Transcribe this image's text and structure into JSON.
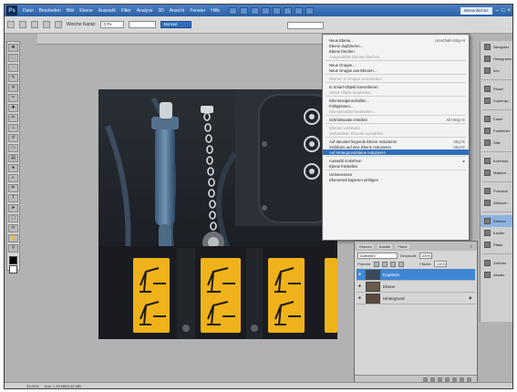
{
  "app": {
    "logo": "Ps",
    "workspace": "Wesentliches",
    "window_controls": [
      "–",
      "□",
      "×"
    ]
  },
  "menu": [
    "Datei",
    "Bearbeiten",
    "Bild",
    "Ebene",
    "Auswahl",
    "Filter",
    "Analyse",
    "3D",
    "Ansicht",
    "Fenster",
    "Hilfe"
  ],
  "options": {
    "feather_label": "Weiche Kante:",
    "feather_value": "0 Px",
    "mode_value": "Normal"
  },
  "context_menu": {
    "items": [
      {
        "label": "Neue Ebene...",
        "shortcut": "Umschalt+Strg+N",
        "state": "normal"
      },
      {
        "label": "Ebene duplizieren...",
        "shortcut": "",
        "state": "normal"
      },
      {
        "label": "Ebene löschen",
        "shortcut": "",
        "state": "normal"
      },
      {
        "label": "Ausgewählte Ebenen löschen",
        "shortcut": "",
        "state": "disabled"
      },
      {
        "label": "Neue Gruppe...",
        "shortcut": "",
        "state": "normal",
        "gap": true
      },
      {
        "label": "Neue Gruppe aus Ebenen...",
        "shortcut": "",
        "state": "normal"
      },
      {
        "label": "Ebenen in Gruppe verschieben",
        "shortcut": "",
        "state": "disabled",
        "gap": true
      },
      {
        "label": "In Smart-Objekt konvertieren",
        "shortcut": "",
        "state": "normal",
        "gap": true
      },
      {
        "label": "Smart-Objekt bearbeiten",
        "shortcut": "",
        "state": "disabled"
      },
      {
        "label": "Ebeneneigenschaften...",
        "shortcut": "",
        "state": "normal",
        "gap": true
      },
      {
        "label": "Fülloptionen...",
        "shortcut": "",
        "state": "normal"
      },
      {
        "label": "Ebenenmaske bearbeiten...",
        "shortcut": "",
        "state": "disabled"
      },
      {
        "label": "Schnittmaske erstellen",
        "shortcut": "Alt+Strg+G",
        "state": "normal",
        "gap": true
      },
      {
        "label": "Ebenen verbinden",
        "shortcut": "",
        "state": "disabled",
        "gap": true
      },
      {
        "label": "Verbundene Ebenen auswählen",
        "shortcut": "",
        "state": "disabled"
      },
      {
        "label": "Auf darunter liegende Ebene reduzieren",
        "shortcut": "Strg+E",
        "state": "normal",
        "gap": true
      },
      {
        "label": "Sichtbare auf eine Ebene reduzieren",
        "shortcut": "Strg+E",
        "state": "normal"
      },
      {
        "label": "Auf Hintergrundebene reduzieren",
        "shortcut": "",
        "state": "active"
      },
      {
        "label": "Auswahl umkehren",
        "shortcut": "",
        "state": "normal",
        "gap": true,
        "submenu": true
      },
      {
        "label": "Ebene freistellen",
        "shortcut": "",
        "state": "normal"
      },
      {
        "label": "Umbenennen",
        "shortcut": "",
        "state": "normal",
        "gap": true
      },
      {
        "label": "Ebenenstil kopieren einfügen",
        "shortcut": "",
        "state": "normal"
      }
    ]
  },
  "dock": {
    "items": [
      {
        "icon": "navigator-icon",
        "label": "Navigator"
      },
      {
        "icon": "histogram-icon",
        "label": "Histogramm"
      },
      {
        "icon": "info-icon",
        "label": "Info"
      },
      {
        "icon": "brush-icon",
        "label": "Pinsel"
      },
      {
        "icon": "clone-source-icon",
        "label": "Kopierqu..."
      },
      {
        "icon": "color-icon",
        "label": "Farbe"
      },
      {
        "icon": "swatches-icon",
        "label": "Farbfelder"
      },
      {
        "icon": "styles-icon",
        "label": "Stile"
      },
      {
        "icon": "adjustments-icon",
        "label": "Korrektur"
      },
      {
        "icon": "masks-icon",
        "label": "Masken"
      },
      {
        "icon": "history-icon",
        "label": "Protokoll"
      },
      {
        "icon": "actions-icon",
        "label": "Aktionen"
      },
      {
        "icon": "layers-icon",
        "label": "Ebenen"
      },
      {
        "icon": "channels-icon",
        "label": "Kanäle"
      },
      {
        "icon": "paths-icon",
        "label": "Pfade"
      },
      {
        "icon": "character-icon",
        "label": "Zeichen"
      },
      {
        "icon": "paragraph-icon",
        "label": "Absatz"
      }
    ],
    "selected_index": 12
  },
  "layers_panel": {
    "tabs": [
      "Ebenen",
      "Kanäle",
      "Pfade"
    ],
    "blend_mode": "Aufhellen",
    "opacity_label": "Deckkraft:",
    "opacity_value": "100%",
    "fill_label": "Fläche:",
    "fill_value": "100%",
    "lock_label": "Fixieren:",
    "layers": [
      {
        "name": "Ergebnis",
        "selected": true,
        "locked": false,
        "thumb": "#3a4a5c"
      },
      {
        "name": "Ebene",
        "selected": false,
        "locked": false,
        "thumb": "#6a5a48"
      },
      {
        "name": "Hintergrund",
        "selected": false,
        "locked": true,
        "thumb": "#5a4a3a"
      }
    ]
  },
  "status": {
    "zoom": "33,33%",
    "doc": "Dok: 1,45 MB/3,89 MB"
  },
  "colors": {
    "accent": "#2f6ebc",
    "selection": "#3f86d4",
    "chrome": "#d6d6d6"
  }
}
